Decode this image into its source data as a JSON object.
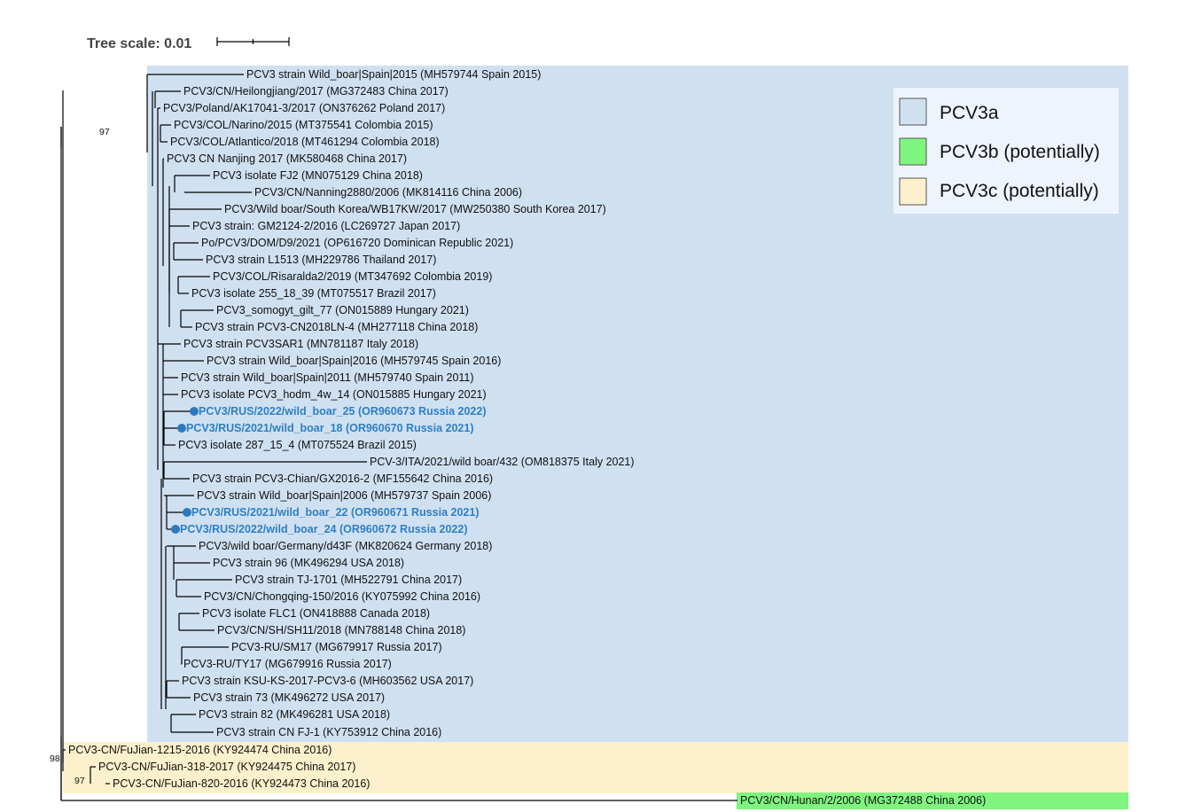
{
  "tree_scale": {
    "label": "Tree scale: 0.01",
    "value": 0.01
  },
  "colors": {
    "pcv3a": "#cfe0f1",
    "pcv3b": "#7ff57f",
    "pcv3c": "#fdf0cc",
    "highlight_text": "#2e7fc4",
    "highlight_dot": "#2f78c0"
  },
  "legend": [
    {
      "label": "PCV3a",
      "color": "#cfe0f1"
    },
    {
      "label": "PCV3b (potentially)",
      "color": "#7ff57f"
    },
    {
      "label": "PCV3c (potentially)",
      "color": "#fdf0cc"
    }
  ],
  "clades": [
    {
      "name": "PCV3a",
      "color": "#cfe0f1"
    },
    {
      "name": "PCV3c",
      "color": "#fdf0cc"
    },
    {
      "name": "PCV3b",
      "color": "#7ff57f"
    }
  ],
  "bootstrap": [
    "97",
    "98",
    "97"
  ],
  "leaves": [
    {
      "label": "PCV3 strain Wild_boar|Spain|2015 (MH579744 Spain 2015)",
      "highlight": false
    },
    {
      "label": "PCV3/CN/Heilongjiang/2017 (MG372483 China 2017)",
      "highlight": false
    },
    {
      "label": "PCV3/Poland/AK17041-3/2017 (ON376262 Poland 2017)",
      "highlight": false
    },
    {
      "label": "PCV3/COL/Narino/2015 (MT375541 Colombia 2015)",
      "highlight": false
    },
    {
      "label": "PCV3/COL/Atlantico/2018 (MT461294 Colombia 2018)",
      "highlight": false
    },
    {
      "label": "PCV3 CN Nanjing 2017 (MK580468 China 2017)",
      "highlight": false
    },
    {
      "label": "PCV3 isolate FJ2 (MN075129 China 2018)",
      "highlight": false
    },
    {
      "label": "PCV3/CN/Nanning2880/2006 (MK814116 China 2006)",
      "highlight": false
    },
    {
      "label": "PCV3/Wild boar/South Korea/WB17KW/2017 (MW250380 South Korea 2017)",
      "highlight": false
    },
    {
      "label": "PCV3 strain: GM2124-2/2016 (LC269727 Japan 2017)",
      "highlight": false
    },
    {
      "label": "Po/PCV3/DOM/D9/2021 (OP616720 Dominican Republic 2021)",
      "highlight": false
    },
    {
      "label": "PCV3 strain L1513 (MH229786 Thailand 2017)",
      "highlight": false
    },
    {
      "label": "PCV3/COL/Risaralda2/2019 (MT347692 Colombia 2019)",
      "highlight": false
    },
    {
      "label": "PCV3 isolate 255_18_39 (MT075517 Brazil 2017)",
      "highlight": false
    },
    {
      "label": "PCV3_somogyt_gilt_77 (ON015889 Hungary 2021)",
      "highlight": false
    },
    {
      "label": "PCV3 strain PCV3-CN2018LN-4 (MH277118 China 2018)",
      "highlight": false
    },
    {
      "label": "PCV3 strain PCV3SAR1 (MN781187 Italy 2018)",
      "highlight": false
    },
    {
      "label": "PCV3 strain Wild_boar|Spain|2016 (MH579745 Spain 2016)",
      "highlight": false
    },
    {
      "label": "PCV3 strain Wild_boar|Spain|2011 (MH579740 Spain 2011)",
      "highlight": false
    },
    {
      "label": "PCV3 isolate PCV3_hodm_4w_14 (ON015885 Hungary 2021)",
      "highlight": false
    },
    {
      "label": "PCV3/RUS/2022/wild_boar_25 (OR960673 Russia 2022)",
      "highlight": true
    },
    {
      "label": "PCV3/RUS/2021/wild_boar_18 (OR960670 Russia 2021)",
      "highlight": true
    },
    {
      "label": "PCV3 isolate 287_15_4 (MT075524 Brazil 2015)",
      "highlight": false
    },
    {
      "label": "PCV-3/ITA/2021/wild boar/432 (OM818375 Italy 2021)",
      "highlight": false
    },
    {
      "label": "PCV3 strain PCV3-Chian/GX2016-2 (MF155642 China 2016)",
      "highlight": false
    },
    {
      "label": "PCV3 strain Wild_boar|Spain|2006 (MH579737 Spain 2006)",
      "highlight": false
    },
    {
      "label": "PCV3/RUS/2021/wild_boar_22 (OR960671 Russia 2021)",
      "highlight": true
    },
    {
      "label": "PCV3/RUS/2022/wild_boar_24 (OR960672 Russia 2022)",
      "highlight": true
    },
    {
      "label": "PCV3/wild boar/Germany/d43F (MK820624 Germany 2018)",
      "highlight": false
    },
    {
      "label": "PCV3 strain 96 (MK496294 USA 2018)",
      "highlight": false
    },
    {
      "label": "PCV3 strain TJ-1701 (MH522791 China 2017)",
      "highlight": false
    },
    {
      "label": "PCV3/CN/Chongqing-150/2016 (KY075992 China 2016)",
      "highlight": false
    },
    {
      "label": "PCV3 isolate FLC1 (ON418888 Canada 2018)",
      "highlight": false
    },
    {
      "label": "PCV3/CN/SH/SH11/2018 (MN788148 China 2018)",
      "highlight": false
    },
    {
      "label": "PCV3-RU/SM17 (MG679917 Russia 2017)",
      "highlight": false
    },
    {
      "label": "PCV3-RU/TY17 (MG679916 Russia 2017)",
      "highlight": false
    },
    {
      "label": "PCV3 strain KSU-KS-2017-PCV3-6 (MH603562 USA 2017)",
      "highlight": false
    },
    {
      "label": "PCV3 strain 73 (MK496272 USA 2017)",
      "highlight": false
    },
    {
      "label": "PCV3 strain 82 (MK496281 USA 2018)",
      "highlight": false
    },
    {
      "label": "PCV3 strain CN FJ-1 (KY753912 China 2016)",
      "highlight": false
    },
    {
      "label": "PCV3-CN/FuJian-1215-2016 (KY924474 China 2016)",
      "highlight": false
    },
    {
      "label": "PCV3-CN/FuJian-318-2017 (KY924475 China 2017)",
      "highlight": false
    },
    {
      "label": "PCV3-CN/FuJian-820-2016 (KY924473 China 2016)",
      "highlight": false
    },
    {
      "label": "PCV3/CN/Hunan/2/2006 (MG372488 China 2006)",
      "highlight": false
    }
  ]
}
